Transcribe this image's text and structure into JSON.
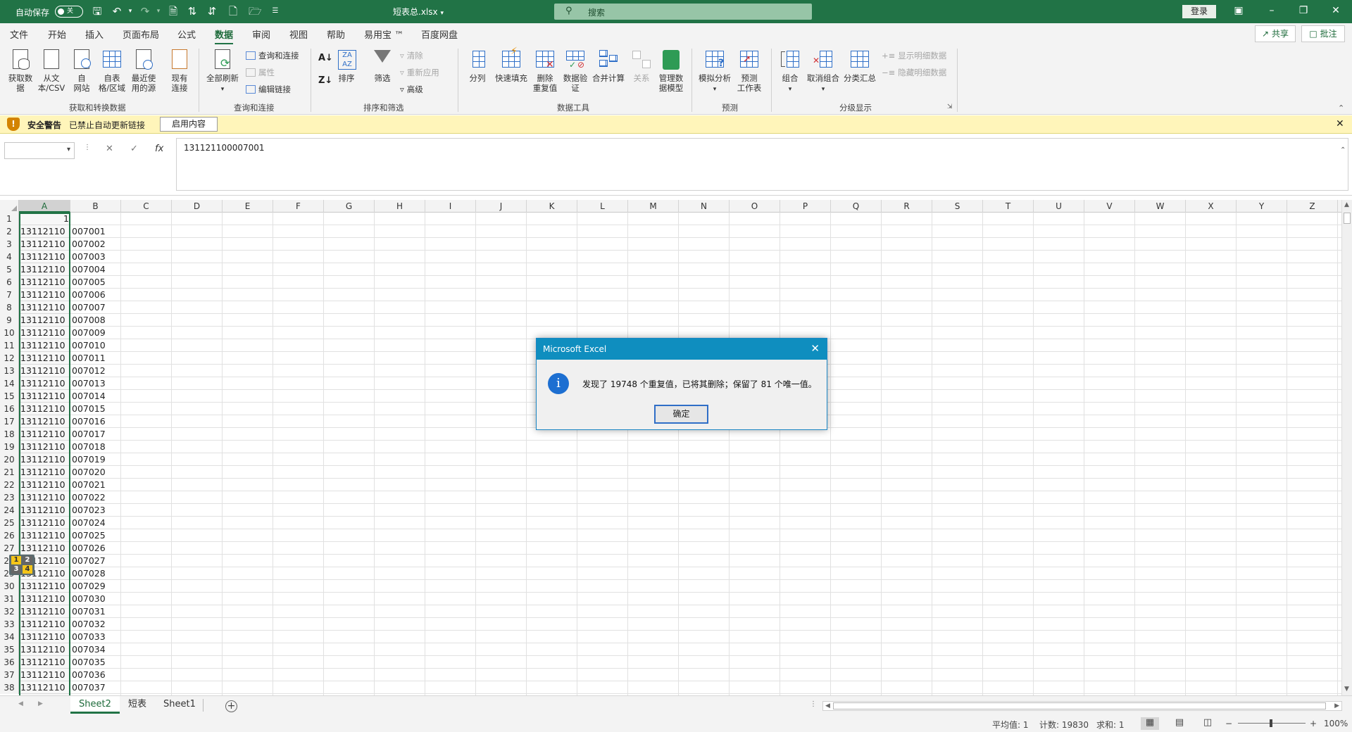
{
  "titlebar": {
    "autosave_label": "自动保存",
    "autosave_state": "关",
    "doc_title": "短表总.xlsx",
    "search_placeholder": "搜索",
    "login_label": "登录",
    "accent_color": "#217346"
  },
  "menu": {
    "tabs": [
      "文件",
      "开始",
      "插入",
      "页面布局",
      "公式",
      "数据",
      "审阅",
      "视图",
      "帮助",
      "易用宝 ™",
      "百度网盘"
    ],
    "active_tab": "数据",
    "share_label": "共享",
    "comment_label": "批注"
  },
  "ribbon": {
    "groups": {
      "get_transform": "获取和转换数据",
      "query_conn": "查询和连接",
      "sort_filter": "排序和筛选",
      "data_tools": "数据工具",
      "forecast": "预测",
      "outline": "分级显示"
    },
    "buttons": {
      "get_data": "获取数\n据",
      "from_csv": "从文\n本/CSV",
      "from_web": "自\n网站",
      "from_table": "自表\n格/区域",
      "recent_sources": "最近使\n用的源",
      "existing_conn": "现有\n连接",
      "refresh_all": "全部刷新",
      "queries_conn": "查询和连接",
      "properties": "属性",
      "edit_links": "编辑链接",
      "sort": "排序",
      "filter": "筛选",
      "clear": "清除",
      "reapply": "重新应用",
      "advanced": "高级",
      "text_to_cols": "分列",
      "flash_fill": "快速填充",
      "remove_dup": "删除\n重复值",
      "validation": "数据验\n证",
      "consolidate": "合并计算",
      "relationships": "关系",
      "data_model": "管理数\n据模型",
      "what_if": "模拟分析",
      "forecast_sheet": "预测\n工作表",
      "group": "组合",
      "ungroup": "取消组合",
      "subtotal": "分类汇总",
      "show_detail": "显示明细数据",
      "hide_detail": "隐藏明细数据"
    }
  },
  "security": {
    "title": "安全警告",
    "message": "已禁止自动更新链接",
    "button": "启用内容"
  },
  "formula_bar": {
    "name_box": "",
    "fx": "fx",
    "content": "131121100007001"
  },
  "columns": [
    "A",
    "B",
    "C",
    "D",
    "E",
    "F",
    "G",
    "H",
    "I",
    "J",
    "K",
    "L",
    "M",
    "N",
    "O",
    "P",
    "Q",
    "R",
    "S",
    "T",
    "U",
    "V",
    "W",
    "X",
    "Y",
    "Z"
  ],
  "rows": [
    {
      "n": "1",
      "a": "1",
      "b": ""
    },
    {
      "n": "2",
      "a": "13112110",
      "b": "007001"
    },
    {
      "n": "3",
      "a": "13112110",
      "b": "007002"
    },
    {
      "n": "4",
      "a": "13112110",
      "b": "007003"
    },
    {
      "n": "5",
      "a": "13112110",
      "b": "007004"
    },
    {
      "n": "6",
      "a": "13112110",
      "b": "007005"
    },
    {
      "n": "7",
      "a": "13112110",
      "b": "007006"
    },
    {
      "n": "8",
      "a": "13112110",
      "b": "007007"
    },
    {
      "n": "9",
      "a": "13112110",
      "b": "007008"
    },
    {
      "n": "10",
      "a": "13112110",
      "b": "007009"
    },
    {
      "n": "11",
      "a": "13112110",
      "b": "007010"
    },
    {
      "n": "12",
      "a": "13112110",
      "b": "007011"
    },
    {
      "n": "13",
      "a": "13112110",
      "b": "007012"
    },
    {
      "n": "14",
      "a": "13112110",
      "b": "007013"
    },
    {
      "n": "15",
      "a": "13112110",
      "b": "007014"
    },
    {
      "n": "16",
      "a": "13112110",
      "b": "007015"
    },
    {
      "n": "17",
      "a": "13112110",
      "b": "007016"
    },
    {
      "n": "18",
      "a": "13112110",
      "b": "007017"
    },
    {
      "n": "19",
      "a": "13112110",
      "b": "007018"
    },
    {
      "n": "20",
      "a": "13112110",
      "b": "007019"
    },
    {
      "n": "21",
      "a": "13112110",
      "b": "007020"
    },
    {
      "n": "22",
      "a": "13112110",
      "b": "007021"
    },
    {
      "n": "23",
      "a": "13112110",
      "b": "007022"
    },
    {
      "n": "24",
      "a": "13112110",
      "b": "007023"
    },
    {
      "n": "25",
      "a": "13112110",
      "b": "007024"
    },
    {
      "n": "26",
      "a": "13112110",
      "b": "007025"
    },
    {
      "n": "27",
      "a": "13112110",
      "b": "007026"
    },
    {
      "n": "28",
      "a": "13112110",
      "b": "007027"
    },
    {
      "n": "29",
      "a": "13112110",
      "b": "007028"
    },
    {
      "n": "30",
      "a": "13112110",
      "b": "007029"
    },
    {
      "n": "31",
      "a": "13112110",
      "b": "007030"
    },
    {
      "n": "32",
      "a": "13112110",
      "b": "007031"
    },
    {
      "n": "33",
      "a": "13112110",
      "b": "007032"
    },
    {
      "n": "34",
      "a": "13112110",
      "b": "007033"
    },
    {
      "n": "35",
      "a": "13112110",
      "b": "007034"
    },
    {
      "n": "36",
      "a": "13112110",
      "b": "007035"
    },
    {
      "n": "37",
      "a": "13112110",
      "b": "007036"
    },
    {
      "n": "38",
      "a": "13112110",
      "b": "007037"
    }
  ],
  "sheets": {
    "tabs": [
      "Sheet2",
      "短表",
      "Sheet1"
    ],
    "active": "Sheet2"
  },
  "status": {
    "average": "平均值: 1",
    "count": "计数: 19830",
    "sum": "求和: 1",
    "zoom": "100%"
  },
  "dialog": {
    "title": "Microsoft Excel",
    "message": "发现了 19748 个重复值，已将其删除；保留了 81 个唯一值。",
    "ok_label": "确定"
  },
  "quick_analysis": {
    "digits": [
      "1",
      "2",
      "3",
      "4"
    ]
  }
}
